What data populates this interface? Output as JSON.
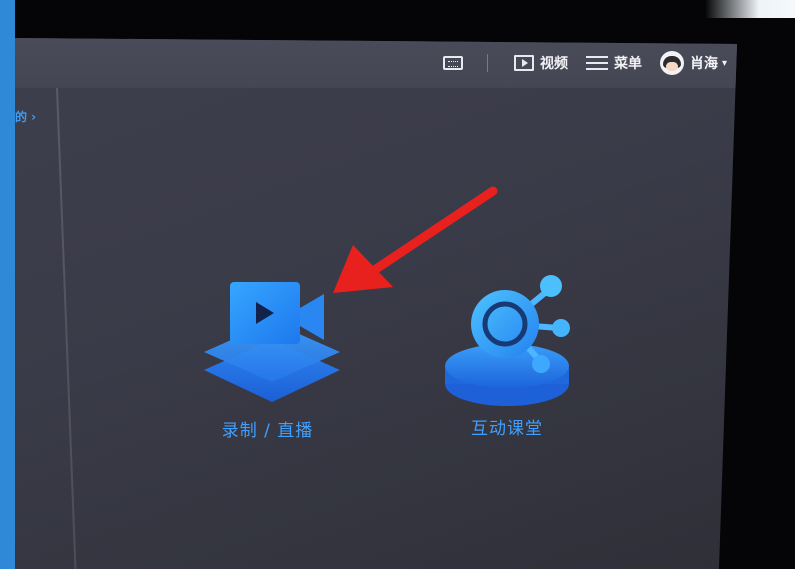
{
  "topbar": {
    "video_label": "视频",
    "menu_label": "菜单",
    "user_name": "肖海",
    "user_chevron": "▾"
  },
  "sidebar": {
    "truncated_link": "的 ›"
  },
  "cards": [
    {
      "label": "录制 / 直播",
      "icon": "video-record-layers-icon"
    },
    {
      "label": "互动课堂",
      "icon": "interactive-class-hub-icon"
    }
  ],
  "colors": {
    "accent": "#3fa0ff",
    "screen_bg": "#3a3b48",
    "topbar_bg": "#474855",
    "annotation_arrow": "#e8211f"
  }
}
